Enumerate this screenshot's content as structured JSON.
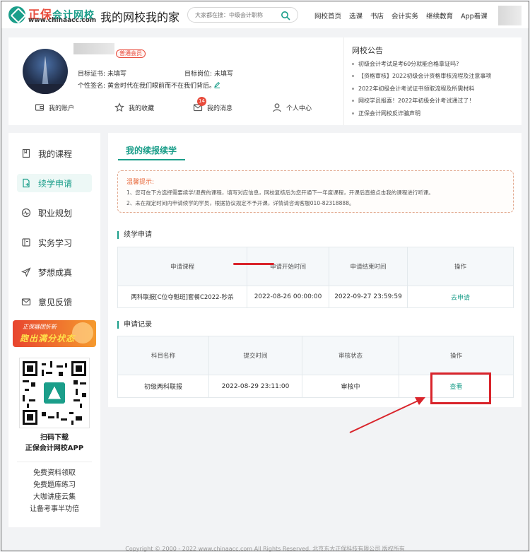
{
  "header": {
    "logo_brand": "正保",
    "logo_name": "会计网校",
    "logo_url": "www.chinaacc.com",
    "slogan": "我的网校我的家",
    "search_placeholder": "大家都在搜：中级会计职称",
    "nav": [
      "网校首页",
      "选课",
      "书店",
      "会计实务",
      "继续教育",
      "App看课"
    ]
  },
  "profile": {
    "member_badge": "普通会员",
    "target_cert_label": "目标证书:",
    "target_cert_value": "未填写",
    "target_job_label": "目标岗位:",
    "target_job_value": "未填写",
    "signature_label": "个性签名:",
    "signature_value": "黄金时代在我们眼前而不在我们背后。",
    "quick_links": [
      "我的账户",
      "我的收藏",
      "我的消息",
      "个人中心"
    ],
    "message_count": "14"
  },
  "notice": {
    "title": "网校公告",
    "items": [
      "初级会计考试是考60分就能合格拿证吗?",
      "【资格审核】2022初级会计资格审核流程及注意事项",
      "2022年初级会计考试证书领取流程及所需材料",
      "网校学员报喜！2022年初级会计考试通过了！",
      "正保会计网校反诈骗声明"
    ]
  },
  "sidebar": {
    "items": [
      "我的课程",
      "续学申请",
      "职业规划",
      "实务学习",
      "梦想成真",
      "意见反馈"
    ],
    "active_index": 1,
    "promo_top": "正保器团折新",
    "promo_main": "跑出满分状态",
    "qr_line1": "扫码下载",
    "qr_line2": "正保会计网校APP",
    "links": [
      "免费资料领取",
      "免费题库练习",
      "大咖讲座云集",
      "让备考事半功倍"
    ]
  },
  "main": {
    "title": "我的续报续学",
    "tips_title": "温馨提示:",
    "tips_1": "1、您可在下方选择需要续学/退费的课程，填写对应信息，网校复核后为您开通下一年度课程，开课后直接点击我的课程进行听课。",
    "tips_2": "2、未在规定时间内申请续学的学员，根据协议规定不予开课，详情请咨询客服010-82318888。",
    "apply_section": "续学申请",
    "apply_headers": [
      "申请课程",
      "申请开始时间",
      "申请结束时间",
      "操作"
    ],
    "apply_row": [
      "两科联报[C位夺魁班]套餐C2022-秒杀",
      "2022-08-26 00:00:00",
      "2022-09-27 23:59:59",
      "去申请"
    ],
    "record_section": "申请记录",
    "record_headers": [
      "科目名称",
      "提交时间",
      "审核状态",
      "操作"
    ],
    "record_row": [
      "初级两科联报",
      "2022-08-29 23:11:00",
      "审核中",
      "查看"
    ]
  },
  "footer": "Copyright © 2000 - 2022 www.chinaacc.com All Rights Reserved. 北京东大正保科技有限公司 版权所有",
  "colors": {
    "accent": "#1b9e8a",
    "brand_red": "#e84b3c",
    "annotation": "#d9242b"
  }
}
